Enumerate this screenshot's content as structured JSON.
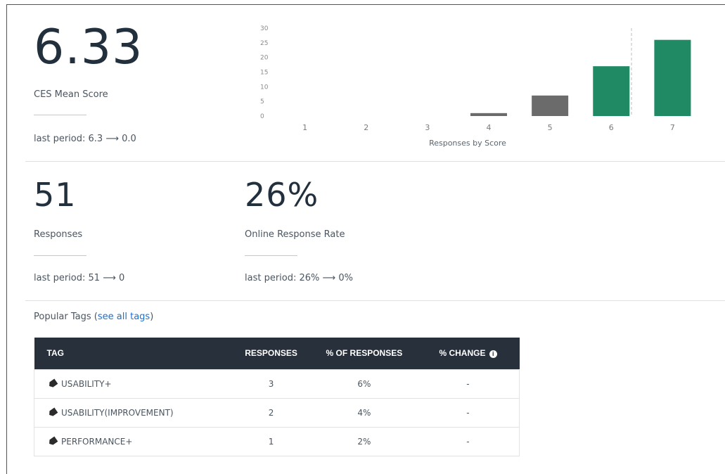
{
  "ces": {
    "value": "6.33",
    "label": "CES Mean Score",
    "last_period": "last period: 6.3",
    "arrow": "⟶",
    "last_current": "0.0"
  },
  "responses": {
    "value": "51",
    "label": "Responses",
    "last_period": "last period: 51",
    "arrow": "⟶",
    "last_current": "0"
  },
  "rate": {
    "value": "26%",
    "label": "Online Response Rate",
    "last_period": "last period: 26%",
    "arrow": "⟶",
    "last_current": "0%"
  },
  "tags": {
    "title": "Popular Tags (",
    "link": "see all tags",
    "title_end": ")",
    "headers": [
      "TAG",
      "RESPONSES",
      "% OF RESPONSES",
      "% CHANGE"
    ],
    "info_glyph": "i",
    "rows": [
      {
        "tag": "USABILITY+",
        "responses": "3",
        "pct": "6%",
        "change": "-"
      },
      {
        "tag": "USABILITY(IMPROVEMENT)",
        "responses": "2",
        "pct": "4%",
        "change": "-"
      },
      {
        "tag": "PERFORMANCE+",
        "responses": "1",
        "pct": "2%",
        "change": "-"
      }
    ]
  },
  "chart_data": {
    "type": "bar",
    "xlabel": "Responses by Score",
    "ylabel": "",
    "categories": [
      "1",
      "2",
      "3",
      "4",
      "5",
      "6",
      "7"
    ],
    "values": [
      0,
      0,
      0,
      1,
      7,
      17,
      26
    ],
    "ylim": [
      0,
      30
    ],
    "yticks": [
      "0",
      "5",
      "10",
      "15",
      "20",
      "25",
      "30"
    ],
    "colors": [
      "#6b6b6b",
      "#6b6b6b",
      "#6b6b6b",
      "#6b6b6b",
      "#6b6b6b",
      "#1f8a63",
      "#1f8a63"
    ],
    "mean_marker": 6.33,
    "grid": false
  }
}
